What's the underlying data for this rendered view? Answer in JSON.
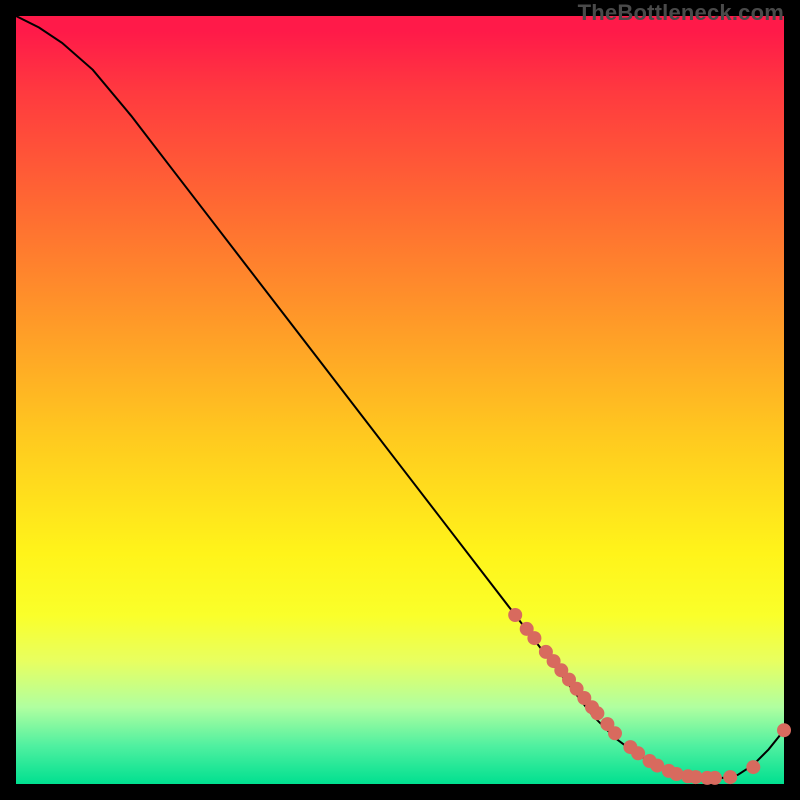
{
  "watermark": "TheBottleneck.com",
  "chart_data": {
    "type": "line",
    "title": "",
    "xlabel": "",
    "ylabel": "",
    "xlim": [
      0,
      100
    ],
    "ylim": [
      0,
      100
    ],
    "grid": false,
    "series": [
      {
        "name": "curve",
        "x": [
          0,
          3,
          6,
          10,
          15,
          20,
          25,
          30,
          35,
          40,
          45,
          50,
          55,
          60,
          65,
          70,
          75,
          78,
          80,
          82,
          84,
          86,
          88,
          90,
          92,
          94,
          96,
          98,
          100
        ],
        "y": [
          100,
          98.5,
          96.5,
          93,
          87,
          80.5,
          74,
          67.5,
          61,
          54.5,
          48,
          41.5,
          35,
          28.5,
          22,
          15.5,
          9,
          6,
          4.5,
          3.2,
          2.2,
          1.5,
          1.0,
          0.8,
          0.8,
          1.2,
          2.5,
          4.5,
          7.0
        ]
      }
    ],
    "points": {
      "name": "dots",
      "x": [
        65,
        66.5,
        67.5,
        69,
        70,
        71,
        72,
        73,
        74,
        75,
        75.7,
        77,
        78,
        80,
        81,
        82.5,
        83.5,
        85,
        86,
        87.5,
        88.5,
        90,
        91,
        93,
        96,
        100
      ],
      "y": [
        22,
        20.2,
        19,
        17.2,
        16,
        14.8,
        13.6,
        12.4,
        11.2,
        10,
        9.2,
        7.8,
        6.6,
        4.8,
        4.0,
        3.0,
        2.4,
        1.7,
        1.3,
        1.0,
        0.9,
        0.8,
        0.8,
        0.9,
        2.2,
        7.0
      ]
    },
    "colors": {
      "curve": "#000000",
      "dots": "#d86a5e",
      "gradient_top": "#ff1a49",
      "gradient_bottom": "#00e090"
    }
  }
}
